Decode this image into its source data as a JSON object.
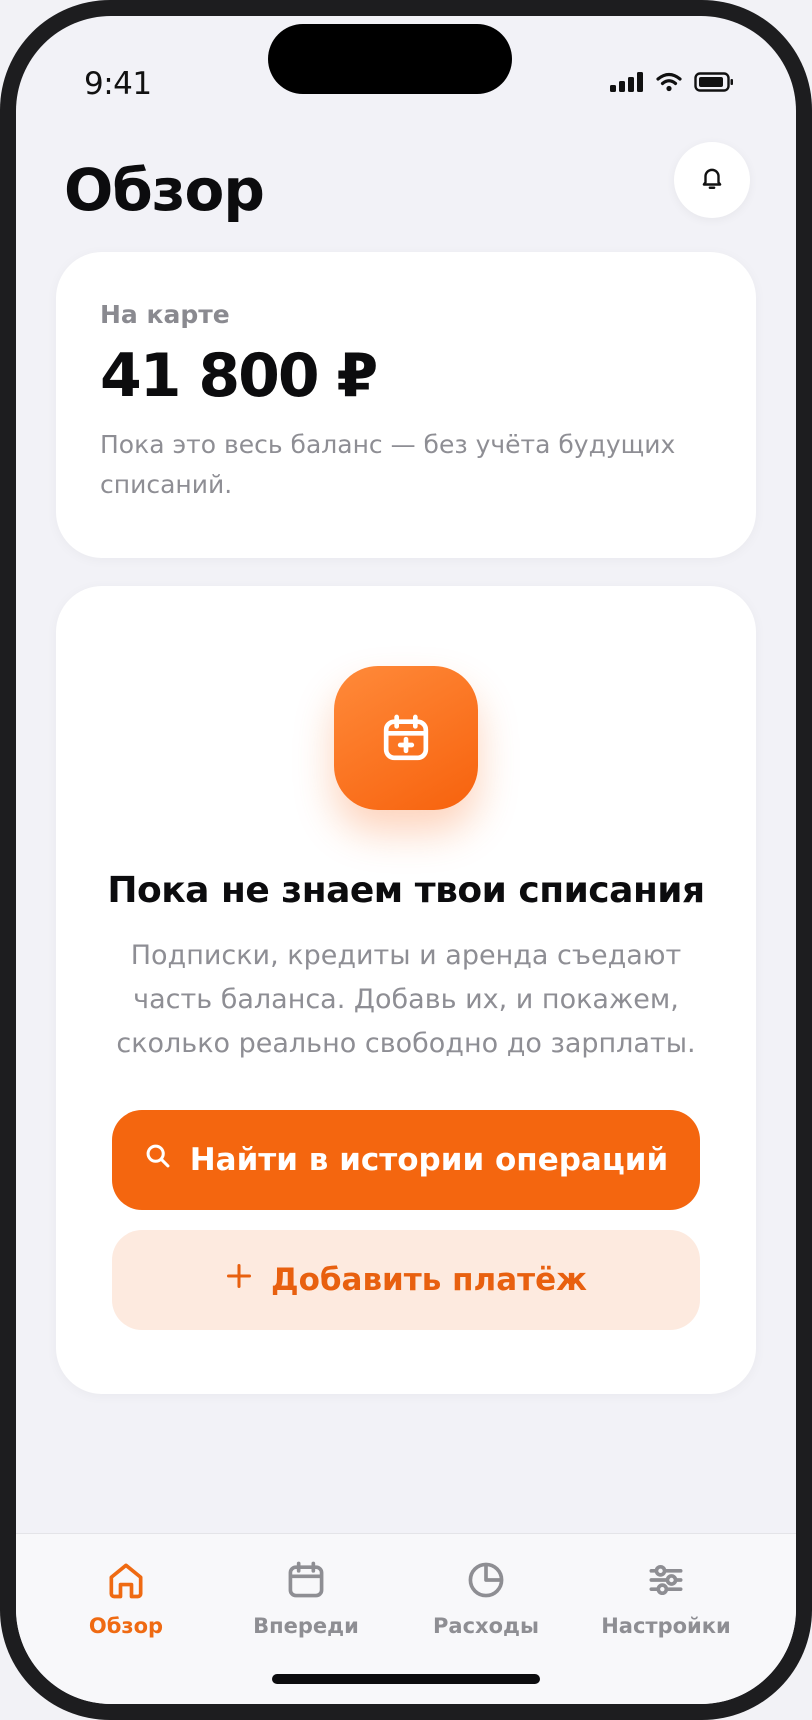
{
  "status_bar": {
    "time": "9:41",
    "icons": [
      "signal-icon",
      "wifi-icon",
      "battery-icon"
    ]
  },
  "header": {
    "title": "Обзор",
    "notification_icon": "bell-icon"
  },
  "balance_card": {
    "label": "На карте",
    "amount": "41 800 ₽",
    "note": "Пока это весь баланс — без учёта будущих списаний."
  },
  "empty_state": {
    "icon": "calendar-plus-icon",
    "title": "Пока не знаем твои списания",
    "text": "Подписки, кредиты и аренда съедают часть баланса. Добавь их, и покажем, сколько реально свободно до зарплаты.",
    "primary_button": {
      "label": "Найти в истории операций",
      "icon": "search-icon"
    },
    "secondary_button": {
      "label": "Добавить платёж",
      "icon": "plus-icon"
    }
  },
  "tabbar": {
    "active": "overview",
    "items": [
      {
        "id": "overview",
        "label": "Обзор",
        "icon": "home-icon"
      },
      {
        "id": "ahead",
        "label": "Впереди",
        "icon": "calendar-icon"
      },
      {
        "id": "expenses",
        "label": "Расходы",
        "icon": "pie-chart-icon"
      },
      {
        "id": "settings",
        "label": "Настройки",
        "icon": "sliders-icon"
      }
    ]
  },
  "colors": {
    "accent": "#f4660f",
    "accent_soft": "#fdeadf",
    "background": "#f2f2f7",
    "text_primary": "#0c0c0e",
    "text_secondary": "#8e8e94"
  }
}
